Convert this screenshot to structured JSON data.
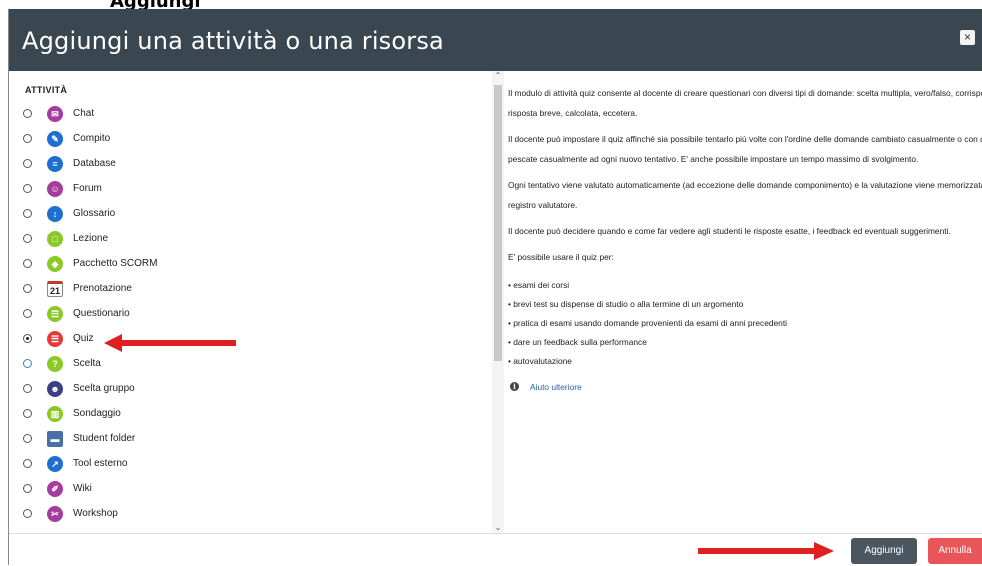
{
  "top_heading": "Aggiungi",
  "dialog": {
    "title": "Aggiungi una attività o una risorsa",
    "close_label": "×"
  },
  "section_title": "ATTIVITÀ",
  "activities": [
    {
      "label": "Chat",
      "icon": "chat-icon",
      "color": "#a63d9e",
      "selected": false
    },
    {
      "label": "Compito",
      "icon": "assignment-icon",
      "color": "#1f6fd1",
      "selected": false
    },
    {
      "label": "Database",
      "icon": "database-icon",
      "color": "#1f6fd1",
      "selected": false
    },
    {
      "label": "Forum",
      "icon": "forum-icon",
      "color": "#a63d9e",
      "selected": false
    },
    {
      "label": "Glossario",
      "icon": "glossary-icon",
      "color": "#1f6fd1",
      "selected": false
    },
    {
      "label": "Lezione",
      "icon": "lesson-icon",
      "color": "#8ac926",
      "selected": false
    },
    {
      "label": "Pacchetto SCORM",
      "icon": "scorm-icon",
      "color": "#8ac926",
      "selected": false
    },
    {
      "label": "Prenotazione",
      "icon": "calendar-icon",
      "color": "#555555",
      "selected": false,
      "calendar_day": "21"
    },
    {
      "label": "Questionario",
      "icon": "questionnaire-icon",
      "color": "#8ac926",
      "selected": false
    },
    {
      "label": "Quiz",
      "icon": "quiz-icon",
      "color": "#e53935",
      "selected": true
    },
    {
      "label": "Scelta",
      "icon": "help-icon",
      "color": "#8ac926",
      "selected": false
    },
    {
      "label": "Scelta gruppo",
      "icon": "group-choice-icon",
      "color": "#3a4080",
      "selected": false
    },
    {
      "label": "Sondaggio",
      "icon": "survey-icon",
      "color": "#8ac926",
      "selected": false
    },
    {
      "label": "Student folder",
      "icon": "folder-icon",
      "color": "#4a6fa5",
      "selected": false
    },
    {
      "label": "Tool esterno",
      "icon": "external-tool-icon",
      "color": "#1f6fd1",
      "selected": false
    },
    {
      "label": "Wiki",
      "icon": "wiki-icon",
      "color": "#a63d9e",
      "selected": false
    },
    {
      "label": "Workshop",
      "icon": "workshop-icon",
      "color": "#a63d9e",
      "selected": false
    }
  ],
  "description": {
    "p1_l1": "Il modulo di attività quiz consente al docente di creare questionari con diversi tipi di domande: scelta multipla, vero/falso, corrispondenza,",
    "p1_l2": "risposta breve, calcolata, eccetera.",
    "p2_l1": "Il docente può impostare il quiz affinché sia possibile tentarlo più volte con l'ordine delle domande cambiato casualmente o con domande",
    "p2_l2": "pescate casualmente ad ogni nuovo tentativo. E' anche possibile impostare un tempo massimo di svolgimento.",
    "p3_l1": "Ogni tentativo viene valutato automaticamente (ad eccezione delle domande componimento) e la valutazione viene memorizzata nel",
    "p3_l2": "registro valutatore.",
    "p4": "Il docente può decidere quando e come far vedere agli studenti le risposte esatte, i feedback ed eventuali suggerimenti.",
    "p5": "E' possibile usare il quiz per:",
    "bullets": [
      "esami dei corsi",
      "brevi test su dispense di studio o alla termine di un argomento",
      "pratica di esami usando domande provenienti da esami di anni precedenti",
      "dare un feedback sulla performance",
      "autovalutazione"
    ],
    "help_link": "Aiuto ulteriore"
  },
  "buttons": {
    "add": "Aggiungi",
    "cancel": "Annulla"
  },
  "colors": {
    "header_bg": "#3a4650",
    "add_button": "#4a5761",
    "cancel_button": "#e9565a",
    "annotation_arrow": "#e02020"
  }
}
